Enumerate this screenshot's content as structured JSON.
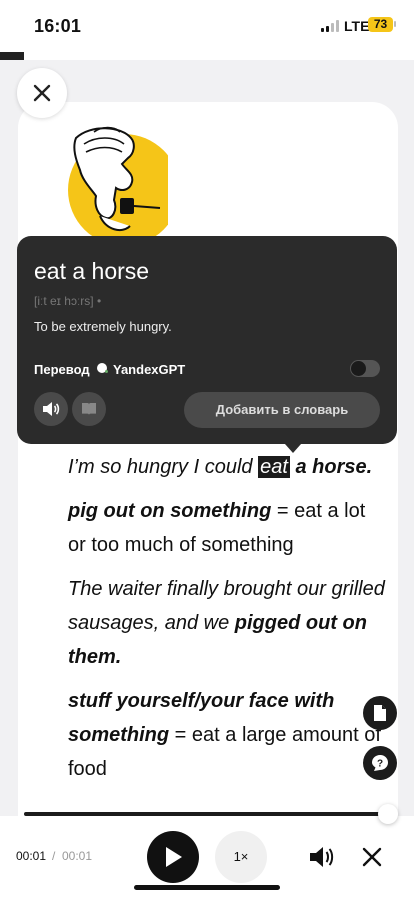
{
  "status_bar": {
    "time": "16:01",
    "network": "LTE",
    "battery": "73"
  },
  "popup": {
    "word": "eat a horse",
    "phonetic": "[iːt eɪ hɔːrs] •",
    "definition": "To be extremely hungry.",
    "translation_label": "Перевод",
    "translation_provider": "YandexGPT",
    "translation_enabled": false,
    "add_button": "Добавить в словарь"
  },
  "article": {
    "ex1_pre": "I’m so hungry I could ",
    "ex1_hl": "eat",
    "ex1_post": " a horse.",
    "term2": "pig out on something",
    "def2": " = eat a lot or too much of something",
    "ex2_pre": "The waiter finally brought our grilled sausages, and we ",
    "ex2_bold": "pigged out on them.",
    "term3": "stuff yourself/your face with something",
    "def3": " = eat a large amount of food"
  },
  "player": {
    "current_time": "00:01",
    "separator": "/",
    "duration": "00:01",
    "speed": "1×",
    "progress": 1.0
  },
  "icons": {
    "close": "close-icon",
    "speaker": "speaker-icon",
    "book": "book-icon",
    "document": "document-icon",
    "help_chat": "help-chat-icon",
    "play": "play-icon",
    "volume": "volume-icon"
  },
  "colors": {
    "accent": "#f5c518",
    "popup_bg": "#2b2b2b",
    "dark": "#111111"
  }
}
